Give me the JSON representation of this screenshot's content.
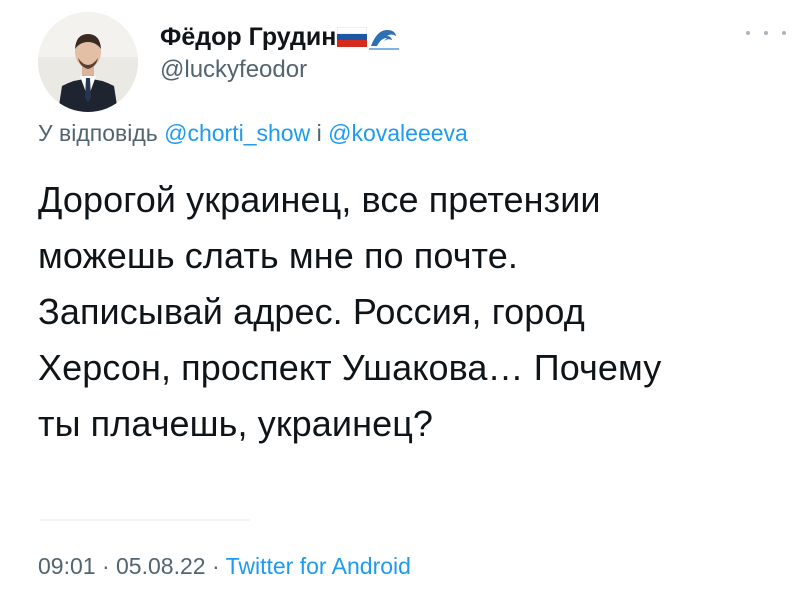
{
  "tweet": {
    "author_name": "Фёдор Грудин",
    "author_handle": "@luckyfeodor",
    "author_flag_icon": "russia-flag-icon",
    "author_emoji_icon": "wave-icon",
    "menu_icon": "more-options-icon",
    "reply_to": {
      "prefix": "У відповідь",
      "mention_1": "@chorti_show",
      "joiner": "і",
      "mention_2": "@kovaleeeva"
    },
    "text_lines": [
      "Дорогой украинец, все претензии",
      "можешь слать мне по почте.",
      "Записывай адрес. Россия, город",
      "Херсон, проспект Ушакова… Почему",
      "ты плачешь, украинец?"
    ],
    "time": "09:01",
    "date": "05.08.22",
    "separator": "·",
    "source": "Twitter for Android"
  },
  "colors": {
    "text": "#0f1419",
    "secondary_text": "#536471",
    "link": "#1d9bf0",
    "background": "#ffffff"
  }
}
